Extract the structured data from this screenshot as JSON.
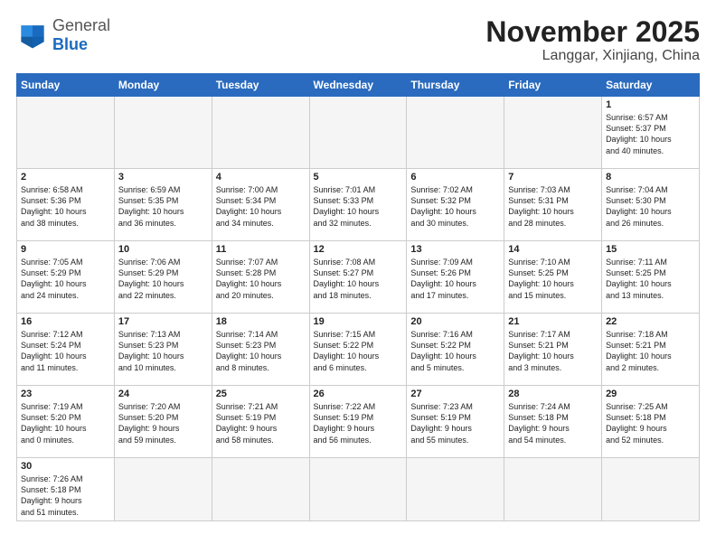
{
  "header": {
    "logo_general": "General",
    "logo_blue": "Blue",
    "title": "November 2025",
    "location": "Langgar, Xinjiang, China"
  },
  "weekdays": [
    "Sunday",
    "Monday",
    "Tuesday",
    "Wednesday",
    "Thursday",
    "Friday",
    "Saturday"
  ],
  "weeks": [
    [
      {
        "day": "",
        "info": ""
      },
      {
        "day": "",
        "info": ""
      },
      {
        "day": "",
        "info": ""
      },
      {
        "day": "",
        "info": ""
      },
      {
        "day": "",
        "info": ""
      },
      {
        "day": "",
        "info": ""
      },
      {
        "day": "1",
        "info": "Sunrise: 6:57 AM\nSunset: 5:37 PM\nDaylight: 10 hours\nand 40 minutes."
      }
    ],
    [
      {
        "day": "2",
        "info": "Sunrise: 6:58 AM\nSunset: 5:36 PM\nDaylight: 10 hours\nand 38 minutes."
      },
      {
        "day": "3",
        "info": "Sunrise: 6:59 AM\nSunset: 5:35 PM\nDaylight: 10 hours\nand 36 minutes."
      },
      {
        "day": "4",
        "info": "Sunrise: 7:00 AM\nSunset: 5:34 PM\nDaylight: 10 hours\nand 34 minutes."
      },
      {
        "day": "5",
        "info": "Sunrise: 7:01 AM\nSunset: 5:33 PM\nDaylight: 10 hours\nand 32 minutes."
      },
      {
        "day": "6",
        "info": "Sunrise: 7:02 AM\nSunset: 5:32 PM\nDaylight: 10 hours\nand 30 minutes."
      },
      {
        "day": "7",
        "info": "Sunrise: 7:03 AM\nSunset: 5:31 PM\nDaylight: 10 hours\nand 28 minutes."
      },
      {
        "day": "8",
        "info": "Sunrise: 7:04 AM\nSunset: 5:30 PM\nDaylight: 10 hours\nand 26 minutes."
      }
    ],
    [
      {
        "day": "9",
        "info": "Sunrise: 7:05 AM\nSunset: 5:29 PM\nDaylight: 10 hours\nand 24 minutes."
      },
      {
        "day": "10",
        "info": "Sunrise: 7:06 AM\nSunset: 5:29 PM\nDaylight: 10 hours\nand 22 minutes."
      },
      {
        "day": "11",
        "info": "Sunrise: 7:07 AM\nSunset: 5:28 PM\nDaylight: 10 hours\nand 20 minutes."
      },
      {
        "day": "12",
        "info": "Sunrise: 7:08 AM\nSunset: 5:27 PM\nDaylight: 10 hours\nand 18 minutes."
      },
      {
        "day": "13",
        "info": "Sunrise: 7:09 AM\nSunset: 5:26 PM\nDaylight: 10 hours\nand 17 minutes."
      },
      {
        "day": "14",
        "info": "Sunrise: 7:10 AM\nSunset: 5:25 PM\nDaylight: 10 hours\nand 15 minutes."
      },
      {
        "day": "15",
        "info": "Sunrise: 7:11 AM\nSunset: 5:25 PM\nDaylight: 10 hours\nand 13 minutes."
      }
    ],
    [
      {
        "day": "16",
        "info": "Sunrise: 7:12 AM\nSunset: 5:24 PM\nDaylight: 10 hours\nand 11 minutes."
      },
      {
        "day": "17",
        "info": "Sunrise: 7:13 AM\nSunset: 5:23 PM\nDaylight: 10 hours\nand 10 minutes."
      },
      {
        "day": "18",
        "info": "Sunrise: 7:14 AM\nSunset: 5:23 PM\nDaylight: 10 hours\nand 8 minutes."
      },
      {
        "day": "19",
        "info": "Sunrise: 7:15 AM\nSunset: 5:22 PM\nDaylight: 10 hours\nand 6 minutes."
      },
      {
        "day": "20",
        "info": "Sunrise: 7:16 AM\nSunset: 5:22 PM\nDaylight: 10 hours\nand 5 minutes."
      },
      {
        "day": "21",
        "info": "Sunrise: 7:17 AM\nSunset: 5:21 PM\nDaylight: 10 hours\nand 3 minutes."
      },
      {
        "day": "22",
        "info": "Sunrise: 7:18 AM\nSunset: 5:21 PM\nDaylight: 10 hours\nand 2 minutes."
      }
    ],
    [
      {
        "day": "23",
        "info": "Sunrise: 7:19 AM\nSunset: 5:20 PM\nDaylight: 10 hours\nand 0 minutes."
      },
      {
        "day": "24",
        "info": "Sunrise: 7:20 AM\nSunset: 5:20 PM\nDaylight: 9 hours\nand 59 minutes."
      },
      {
        "day": "25",
        "info": "Sunrise: 7:21 AM\nSunset: 5:19 PM\nDaylight: 9 hours\nand 58 minutes."
      },
      {
        "day": "26",
        "info": "Sunrise: 7:22 AM\nSunset: 5:19 PM\nDaylight: 9 hours\nand 56 minutes."
      },
      {
        "day": "27",
        "info": "Sunrise: 7:23 AM\nSunset: 5:19 PM\nDaylight: 9 hours\nand 55 minutes."
      },
      {
        "day": "28",
        "info": "Sunrise: 7:24 AM\nSunset: 5:18 PM\nDaylight: 9 hours\nand 54 minutes."
      },
      {
        "day": "29",
        "info": "Sunrise: 7:25 AM\nSunset: 5:18 PM\nDaylight: 9 hours\nand 52 minutes."
      }
    ],
    [
      {
        "day": "30",
        "info": "Sunrise: 7:26 AM\nSunset: 5:18 PM\nDaylight: 9 hours\nand 51 minutes."
      },
      {
        "day": "",
        "info": ""
      },
      {
        "day": "",
        "info": ""
      },
      {
        "day": "",
        "info": ""
      },
      {
        "day": "",
        "info": ""
      },
      {
        "day": "",
        "info": ""
      },
      {
        "day": "",
        "info": ""
      }
    ]
  ]
}
